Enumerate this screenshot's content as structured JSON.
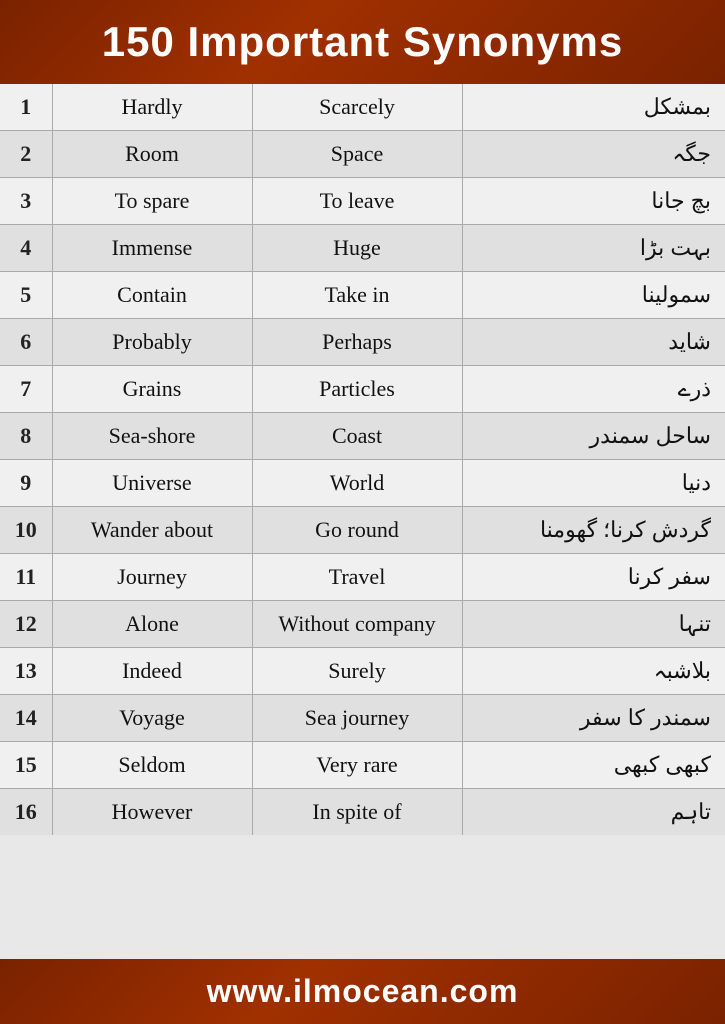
{
  "header": {
    "title": "150 Important Synonyms"
  },
  "watermark": {
    "line1": "ilmocean",
    "url": "www.ilmocean.com"
  },
  "table": {
    "rows": [
      {
        "num": "1",
        "word": "Hardly",
        "synonym": "Scarcely",
        "urdu": "بمشکل"
      },
      {
        "num": "2",
        "word": "Room",
        "synonym": "Space",
        "urdu": "جگہ"
      },
      {
        "num": "3",
        "word": "To spare",
        "synonym": "To leave",
        "urdu": "بچ جانا"
      },
      {
        "num": "4",
        "word": "Immense",
        "synonym": "Huge",
        "urdu": "بہت بڑا"
      },
      {
        "num": "5",
        "word": "Contain",
        "synonym": "Take in",
        "urdu": "سمولینا"
      },
      {
        "num": "6",
        "word": "Probably",
        "synonym": "Perhaps",
        "urdu": "شاید"
      },
      {
        "num": "7",
        "word": "Grains",
        "synonym": "Particles",
        "urdu": "ذرے"
      },
      {
        "num": "8",
        "word": "Sea-shore",
        "synonym": "Coast",
        "urdu": "ساحل سمندر"
      },
      {
        "num": "9",
        "word": "Universe",
        "synonym": "World",
        "urdu": "دنیا"
      },
      {
        "num": "10",
        "word": "Wander about",
        "synonym": "Go round",
        "urdu": "گردش کرنا؛ گھومنا"
      },
      {
        "num": "11",
        "word": "Journey",
        "synonym": "Travel",
        "urdu": "سفر کرنا"
      },
      {
        "num": "12",
        "word": "Alone",
        "synonym": "Without company",
        "urdu": "تنہا"
      },
      {
        "num": "13",
        "word": "Indeed",
        "synonym": "Surely",
        "urdu": "بلاشبہ"
      },
      {
        "num": "14",
        "word": "Voyage",
        "synonym": "Sea journey",
        "urdu": "سمندر کا سفر"
      },
      {
        "num": "15",
        "word": "Seldom",
        "synonym": "Very rare",
        "urdu": "کبھی کبھی"
      },
      {
        "num": "16",
        "word": "However",
        "synonym": "In spite of",
        "urdu": "تاہم"
      }
    ]
  },
  "footer": {
    "url": "www.ilmocean.com"
  }
}
